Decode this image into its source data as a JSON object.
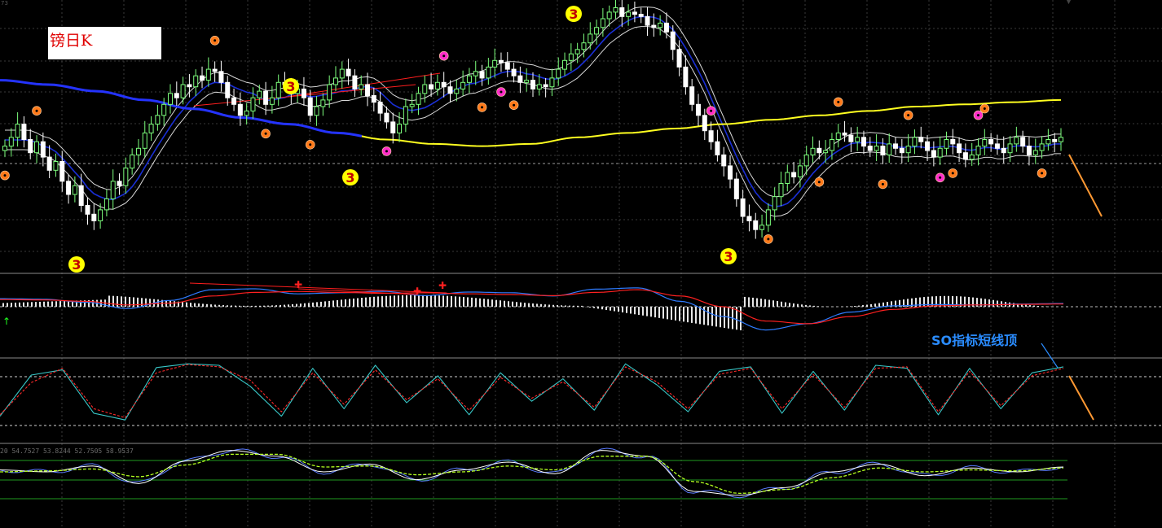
{
  "chart_title": "镑日K",
  "annotation": "SO指标短线顶",
  "indicator_values": "20 54.7527 53.8244 52.7505 58.9537",
  "corner": {
    "number": "73",
    "glyph": "▼"
  },
  "colors": {
    "background": "#000000",
    "bull_candle": "#7dff7d",
    "bear_candle": "#ffffff",
    "ma_long_blue": "#2433ff",
    "ma_long_yellow": "#ffff20",
    "env_white": "#d8d8d8",
    "env_mid": "#1a2fd6",
    "macd_fast": "#2e7bff",
    "macd_slow": "#ff2020",
    "histogram": "#e6e6e6",
    "so_main": "#38c6c6",
    "so_signal": "#ff2a2a",
    "rsi_white": "#ffffff",
    "rsi_blue": "#5a7bff",
    "rsi_lime": "#b4ff20",
    "trend_lines": "#ff1e1e",
    "forecast_orange": "#ff9933",
    "wave_yellow": "#ffff00",
    "bull_dot": "#ff7a1a",
    "bear_dot": "#ff2ec8"
  },
  "chart_data": [
    {
      "type": "candlestick",
      "series": [
        {
          "name": "close",
          "values": [
            0.52,
            0.56,
            0.62,
            0.55,
            0.49,
            0.54,
            0.47,
            0.41,
            0.45,
            0.36,
            0.3,
            0.34,
            0.25,
            0.21,
            0.18,
            0.23,
            0.28,
            0.36,
            0.34,
            0.42,
            0.48,
            0.51,
            0.58,
            0.62,
            0.66,
            0.71,
            0.76,
            0.74,
            0.8,
            0.79,
            0.84,
            0.82,
            0.87,
            0.86,
            0.81,
            0.74,
            0.71,
            0.66,
            0.68,
            0.74,
            0.77,
            0.71,
            0.74,
            0.81,
            0.8,
            0.76,
            0.78,
            0.74,
            0.66,
            0.7,
            0.73,
            0.8,
            0.83,
            0.87,
            0.84,
            0.78,
            0.8,
            0.75,
            0.72,
            0.67,
            0.63,
            0.58,
            0.62,
            0.7,
            0.71,
            0.76,
            0.8,
            0.78,
            0.81,
            0.79,
            0.76,
            0.78,
            0.81,
            0.84,
            0.86,
            0.83,
            0.88,
            0.91,
            0.9,
            0.87,
            0.84,
            0.81,
            0.82,
            0.78,
            0.8,
            0.79,
            0.83,
            0.87,
            0.91,
            0.94,
            0.96,
            0.99,
            1.03,
            1.06,
            1.1,
            1.13,
            1.15,
            1.11,
            1.13,
            1.12,
            1.11,
            1.07,
            1.06,
            1.08,
            1.04,
            0.96,
            0.88,
            0.79,
            0.71,
            0.66,
            0.59,
            0.54,
            0.48,
            0.43,
            0.37,
            0.28,
            0.2,
            0.18,
            0.14,
            0.16,
            0.23,
            0.29,
            0.35,
            0.4,
            0.38,
            0.43,
            0.48,
            0.51,
            0.49,
            0.5,
            0.55,
            0.58,
            0.57,
            0.54,
            0.56,
            0.52,
            0.5,
            0.52,
            0.48,
            0.53,
            0.51,
            0.49,
            0.52,
            0.56,
            0.54,
            0.5,
            0.47,
            0.51,
            0.55,
            0.53,
            0.49,
            0.46,
            0.48,
            0.52,
            0.55,
            0.53,
            0.51,
            0.49,
            0.53,
            0.56,
            0.52,
            0.48,
            0.5,
            0.53,
            0.55,
            0.54,
            0.56
          ]
        },
        {
          "name": "MA yellow/blue",
          "values": [
            0.82,
            0.8,
            0.77,
            0.73,
            0.69,
            0.65,
            0.62,
            0.58,
            0.55,
            0.53,
            0.52,
            0.53,
            0.56,
            0.58,
            0.6,
            0.62,
            0.64,
            0.66,
            0.68,
            0.7,
            0.71,
            0.72,
            0.73
          ]
        }
      ]
    },
    {
      "type": "line",
      "series": [
        {
          "name": "macd_fast",
          "values": [
            0.45,
            0.42,
            0.25,
            -0.1,
            0.35,
            0.95,
            1.0,
            0.72,
            0.78,
            0.86,
            0.62,
            0.82,
            0.78,
            0.6,
            0.98,
            1.05,
            0.3,
            -0.55,
            -1.3,
            -0.95,
            -0.3,
            0.05,
            0.12,
            0.1,
            0.15,
            0.18
          ]
        },
        {
          "name": "macd_slow",
          "values": [
            0.4,
            0.38,
            0.3,
            0.1,
            0.2,
            0.6,
            0.8,
            0.85,
            0.8,
            0.75,
            0.78,
            0.72,
            0.68,
            0.62,
            0.8,
            0.95,
            0.6,
            0.0,
            -0.8,
            -0.95,
            -0.55,
            -0.15,
            0.05,
            0.1,
            0.13,
            0.15
          ]
        }
      ]
    },
    {
      "type": "line",
      "series": [
        {
          "name": "so_main",
          "values": [
            20,
            75,
            82,
            24,
            15,
            85,
            90,
            88,
            60,
            20,
            84,
            30,
            88,
            38,
            74,
            22,
            78,
            40,
            70,
            28,
            90,
            62,
            26,
            80,
            86,
            24,
            80,
            28,
            88,
            84,
            22,
            84,
            30,
            78,
            86
          ]
        },
        {
          "name": "so_signal",
          "values": [
            22,
            65,
            84,
            30,
            18,
            78,
            89,
            86,
            68,
            26,
            78,
            36,
            82,
            42,
            70,
            28,
            72,
            44,
            66,
            32,
            86,
            66,
            30,
            76,
            84,
            30,
            76,
            32,
            84,
            86,
            26,
            80,
            34,
            74,
            84
          ]
        }
      ]
    },
    {
      "type": "line",
      "series": [
        {
          "name": "rsi_white",
          "values": [
            52,
            50,
            56,
            38,
            61,
            72,
            66,
            50,
            58,
            42,
            52,
            60,
            48,
            72,
            66,
            30,
            26,
            34,
            50,
            58,
            46,
            54,
            50,
            55
          ]
        },
        {
          "name": "rsi_lime",
          "values": [
            50,
            51,
            53,
            45,
            57,
            68,
            68,
            55,
            56,
            47,
            50,
            56,
            52,
            66,
            66,
            40,
            28,
            32,
            44,
            54,
            50,
            52,
            51,
            54
          ]
        }
      ]
    }
  ]
}
